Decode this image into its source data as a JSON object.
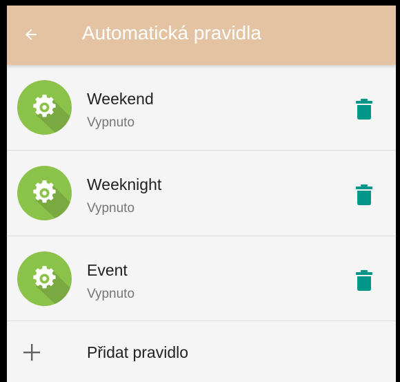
{
  "colors": {
    "appbar": "#e4c3a2",
    "avatar": "#8bc34a",
    "delete_icon": "#009688",
    "background": "#f5f5f5"
  },
  "appbar": {
    "title": "Automatická pravidla",
    "back_icon": "arrow-left-icon"
  },
  "rules": [
    {
      "name": "Weekend",
      "status": "Vypnuto",
      "icon": "gear-icon",
      "action_icon": "trash-icon"
    },
    {
      "name": "Weeknight",
      "status": "Vypnuto",
      "icon": "gear-icon",
      "action_icon": "trash-icon"
    },
    {
      "name": "Event",
      "status": "Vypnuto",
      "icon": "gear-icon",
      "action_icon": "trash-icon"
    }
  ],
  "add_rule": {
    "label": "Přidat pravidlo",
    "icon": "plus-icon"
  }
}
